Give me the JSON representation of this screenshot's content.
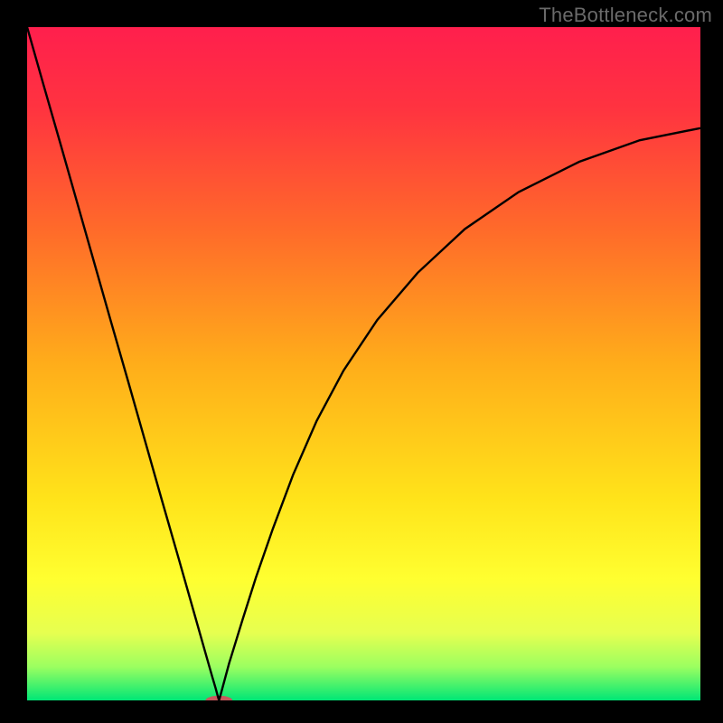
{
  "watermark": "TheBottleneck.com",
  "chart_data": {
    "type": "line",
    "title": "",
    "xlabel": "",
    "ylabel": "",
    "xlim": [
      0,
      100
    ],
    "ylim": [
      0,
      100
    ],
    "grid": false,
    "background_gradient": [
      {
        "offset": 0.0,
        "color": "#ff1f4d"
      },
      {
        "offset": 0.12,
        "color": "#ff3340"
      },
      {
        "offset": 0.3,
        "color": "#ff6a2a"
      },
      {
        "offset": 0.5,
        "color": "#ffad1a"
      },
      {
        "offset": 0.7,
        "color": "#ffe31a"
      },
      {
        "offset": 0.82,
        "color": "#ffff30"
      },
      {
        "offset": 0.9,
        "color": "#e6ff50"
      },
      {
        "offset": 0.95,
        "color": "#9cff60"
      },
      {
        "offset": 1.0,
        "color": "#00e676"
      }
    ],
    "series": [
      {
        "name": "bottleneck-curve",
        "color": "#000000",
        "x": [
          0.0,
          2.5,
          5.0,
          7.5,
          10.0,
          12.5,
          15.0,
          17.5,
          20.0,
          22.5,
          25.0,
          26.5,
          27.5,
          28.0,
          28.3,
          28.5,
          28.7,
          29.0,
          30.0,
          32.0,
          34.0,
          36.5,
          39.5,
          43.0,
          47.0,
          52.0,
          58.0,
          65.0,
          73.0,
          82.0,
          91.0,
          100.0
        ],
        "y": [
          100.0,
          91.2,
          82.5,
          73.7,
          64.9,
          56.1,
          47.4,
          38.6,
          29.8,
          21.1,
          12.3,
          7.0,
          3.5,
          1.8,
          0.7,
          0.0,
          0.7,
          1.8,
          5.5,
          12.0,
          18.3,
          25.5,
          33.5,
          41.5,
          49.0,
          56.5,
          63.5,
          70.0,
          75.5,
          80.0,
          83.2,
          85.0
        ]
      }
    ],
    "marker": {
      "name": "optimal-zone-marker",
      "cx": 28.5,
      "cy": 0.0,
      "rx": 2.0,
      "ry": 0.7,
      "color": "#c65a5d"
    }
  }
}
